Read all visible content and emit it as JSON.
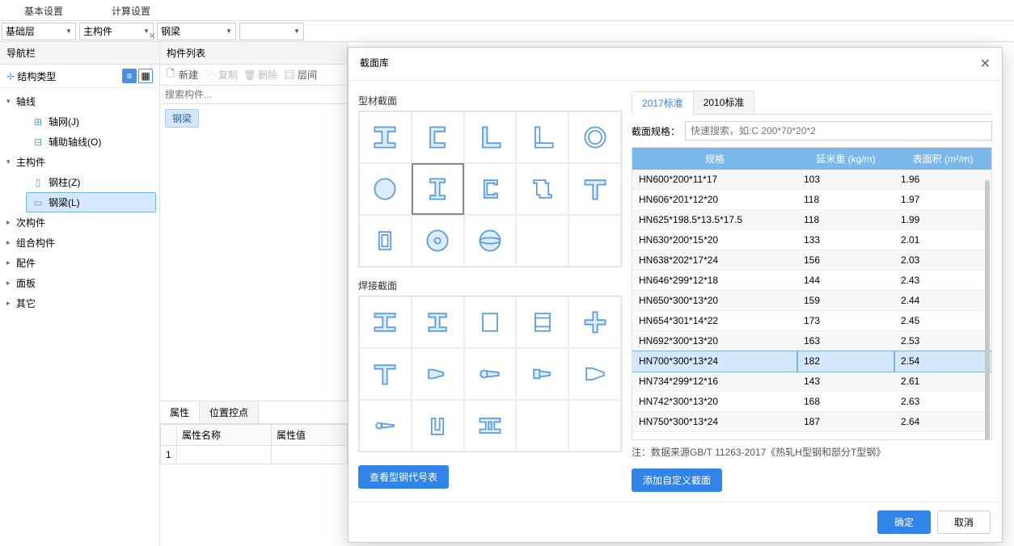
{
  "topTabs": {
    "basic": "基本设置",
    "calc": "计算设置"
  },
  "filters": {
    "level": "基础层",
    "category": "主构件",
    "type": "钢梁",
    "empty": ""
  },
  "nav": {
    "title": "导航栏",
    "structType": "结构类型",
    "axis": {
      "label": "轴线",
      "items": {
        "grid": "轴网(J)",
        "aux": "辅助轴线(O)"
      }
    },
    "main": {
      "label": "主构件",
      "items": {
        "col": "钢柱(Z)",
        "beam": "钢梁(L)"
      }
    },
    "secondary": "次构件",
    "composite": "组合构件",
    "parts": "配件",
    "panel": "面板",
    "other": "其它"
  },
  "list": {
    "title": "构件列表",
    "toolbar": {
      "new": "新建",
      "copy": "复制",
      "delete": "删除",
      "layer": "层间",
      "tail": ""
    },
    "searchPlaceholder": "搜索构件...",
    "chip": "钢梁"
  },
  "prop": {
    "tabs": {
      "attr": "属性",
      "pos": "位置控点"
    },
    "cols": {
      "name": "属性名称",
      "val": "属性值"
    },
    "rowNum": "1"
  },
  "dialog": {
    "title": "截面库",
    "leftSections": {
      "profile": "型材截面",
      "welded": "焊接截面"
    },
    "viewCodeBtn": "查看型钢代号表",
    "stdTabs": {
      "s2017": "2017标准",
      "s2010": "2010标准"
    },
    "specLabel": "截面规格：",
    "specPlaceholder": "快速搜索，如:C 200*70*20*2",
    "tableHeaders": {
      "spec": "规格",
      "weight": "延米重 (kg/m)",
      "area": "表面积 (m²/m)"
    },
    "rows": [
      {
        "spec": "HN600*200*11*17",
        "w": "103",
        "a": "1.96"
      },
      {
        "spec": "HN606*201*12*20",
        "w": "118",
        "a": "1.97"
      },
      {
        "spec": "HN625*198.5*13.5*17.5",
        "w": "118",
        "a": "1.99"
      },
      {
        "spec": "HN630*200*15*20",
        "w": "133",
        "a": "2.01"
      },
      {
        "spec": "HN638*202*17*24",
        "w": "156",
        "a": "2.03"
      },
      {
        "spec": "HN646*299*12*18",
        "w": "144",
        "a": "2.43"
      },
      {
        "spec": "HN650*300*13*20",
        "w": "159",
        "a": "2.44"
      },
      {
        "spec": "HN654*301*14*22",
        "w": "173",
        "a": "2.45"
      },
      {
        "spec": "HN692*300*13*20",
        "w": "163",
        "a": "2.53"
      },
      {
        "spec": "HN700*300*13*24",
        "w": "182",
        "a": "2.54",
        "selected": true
      },
      {
        "spec": "HN734*299*12*16",
        "w": "143",
        "a": "2.61"
      },
      {
        "spec": "HN742*300*13*20",
        "w": "168",
        "a": "2.63"
      },
      {
        "spec": "HN750*300*13*24",
        "w": "187",
        "a": "2.64"
      }
    ],
    "note": "注：数据来源GB/T 11263-2017《热轧H型钢和部分T型钢》",
    "addCustom": "添加自定义截面",
    "ok": "确定",
    "cancel": "取消"
  }
}
